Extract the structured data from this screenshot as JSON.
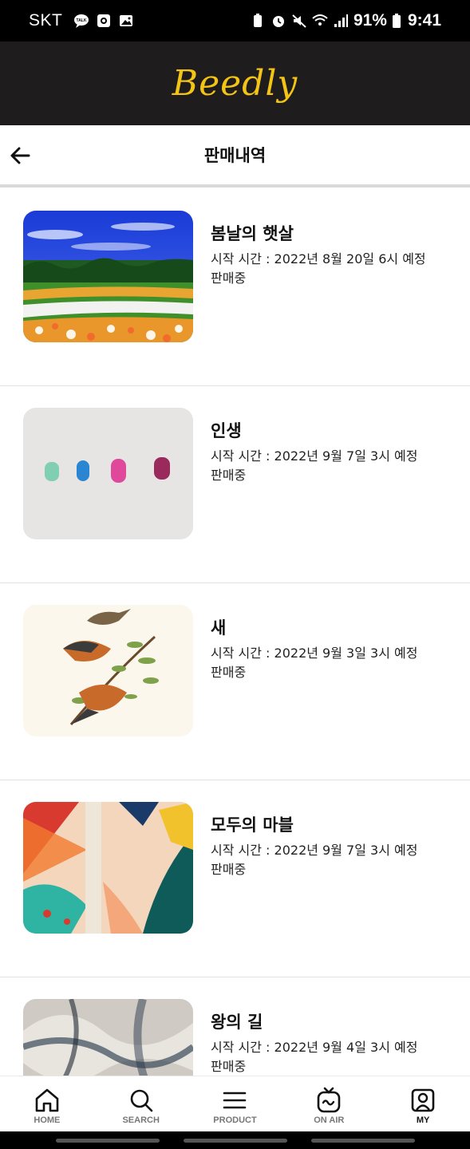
{
  "status_bar": {
    "carrier": "SKT",
    "battery": "91%",
    "time": "9:41"
  },
  "app": {
    "logo": "Beedly",
    "accent_color": "#f3c316",
    "header_bg": "#1e1c1c"
  },
  "page": {
    "title": "판매내역",
    "back_icon": "arrow-left-icon"
  },
  "sales": [
    {
      "name": "봄날의 햇살",
      "time": "시작 시간 : 2022년 8월 20일 6시 예정",
      "status": "판매중",
      "image": "flower-field"
    },
    {
      "name": "인생",
      "time": "시작 시간 : 2022년 9월 7일 3시 예정",
      "status": "판매중",
      "image": "paint-strokes"
    },
    {
      "name": "새",
      "time": "시작 시간 : 2022년 9월 3일 3시 예정",
      "status": "판매중",
      "image": "birds-illustration"
    },
    {
      "name": "모두의 마블",
      "time": "시작 시간 : 2022년 9월 7일 3시 예정",
      "status": "판매중",
      "image": "abstract-mural"
    },
    {
      "name": "왕의 길",
      "time": "시작 시간 : 2022년 9월 4일 3시 예정",
      "status": "판매중",
      "image": "marble-swirl"
    }
  ],
  "bottom_nav": [
    {
      "label": "HOME",
      "icon": "home-icon"
    },
    {
      "label": "SEARCH",
      "icon": "search-icon"
    },
    {
      "label": "PRODUCT",
      "icon": "menu-icon"
    },
    {
      "label": "ON AIR",
      "icon": "tv-icon"
    },
    {
      "label": "MY",
      "icon": "profile-icon",
      "active": true
    }
  ]
}
